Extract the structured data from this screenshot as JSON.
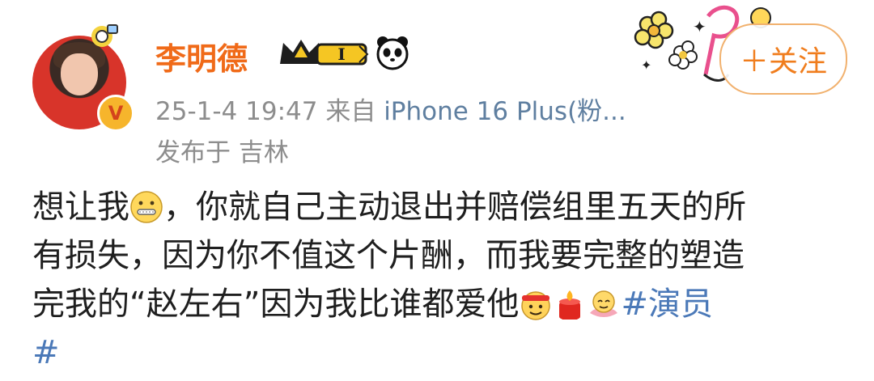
{
  "user": {
    "name": "李明德",
    "level_label": "I",
    "verified_symbol": "V",
    "avatar_icon": "avatar-portrait",
    "badge_icons": [
      "crown-badge-icon",
      "panda-icon"
    ]
  },
  "post_meta": {
    "timestamp": "25-1-4 19:47",
    "source_prefix": "来自",
    "source": "iPhone 16 Plus(粉...",
    "location": "发布于 吉林"
  },
  "follow_button": {
    "label": "＋关注"
  },
  "post": {
    "line1_a": "想让我",
    "line1_b": "，你就自己主动退出并赔偿组里五天的所",
    "line2": "有损失，因为你不值这个片酬，而我要完整的塑造",
    "line3_a": "完我的“赵左右”因为我比谁都爱他",
    "hashtag_part1": "#演员",
    "hashtag_part2": "#"
  },
  "colors": {
    "username": "#f06a18",
    "meta": "#8d8d8d",
    "source_link": "#5f7fa0",
    "hashtag": "#4b79b8",
    "follow_border": "#f1b16e",
    "follow_text": "#f07d1d"
  }
}
